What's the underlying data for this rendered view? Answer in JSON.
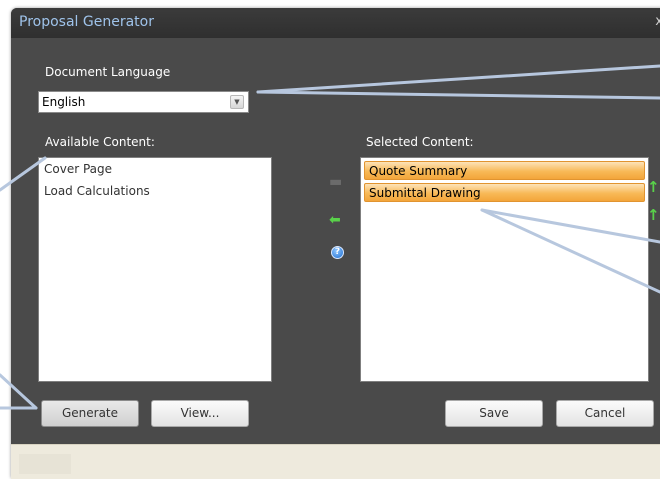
{
  "window": {
    "title": "Proposal Generator",
    "close_glyph": "x"
  },
  "document_language": {
    "label": "Document Language",
    "value": "English",
    "dropdown_icon": "chevron-down-icon"
  },
  "available_content": {
    "label": "Available Content:",
    "items": [
      "Cover Page",
      "Load Calculations"
    ]
  },
  "selected_content": {
    "label": "Selected Content:",
    "items": [
      "Quote Summary",
      "Submittal Drawing"
    ]
  },
  "transfer_controls": {
    "add_icon": "right-arrow-icon",
    "remove_icon": "left-arrow-icon",
    "help_icon": "help-icon",
    "move_up_icon": "up-arrow-icon",
    "move_down_icon": "down-arrow-icon"
  },
  "buttons": {
    "generate": "Generate",
    "view": "View...",
    "save": "Save",
    "cancel": "Cancel"
  },
  "colors": {
    "dialog_bg": "#4a4a4a",
    "title_text": "#9fc3ea",
    "selection_orange": "#f8b957",
    "callout_line": "#b7c7de",
    "arrow_green": "#59d14a"
  }
}
